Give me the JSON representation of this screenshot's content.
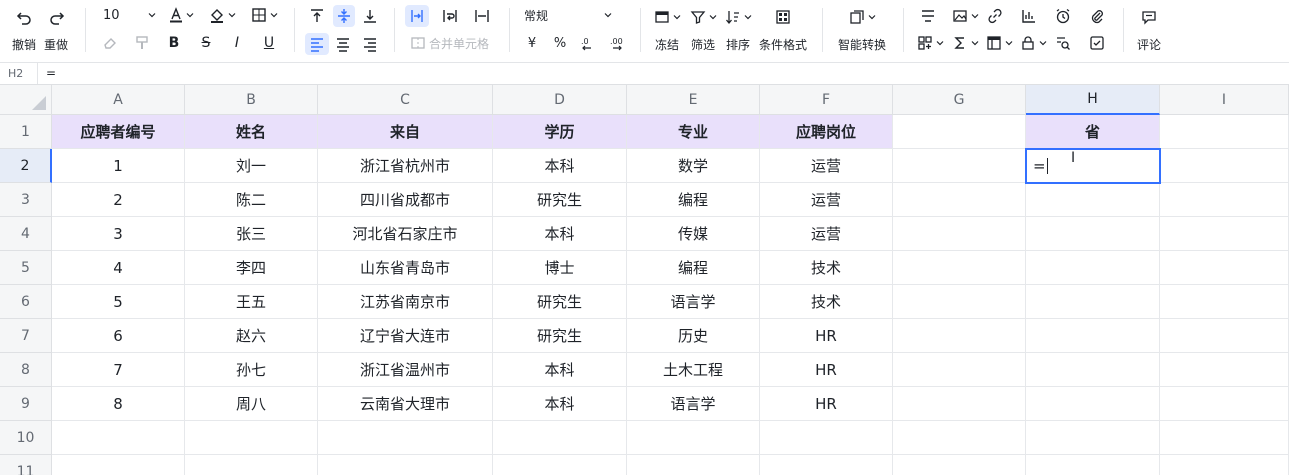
{
  "toolbar": {
    "undo_label": "撤销",
    "redo_label": "重做",
    "font_size": "10",
    "merge_label": "合并单元格",
    "number_format": "常规",
    "currency_symbol": "¥",
    "percent_symbol": "%",
    "freeze_label": "冻结",
    "filter_label": "筛选",
    "sort_label": "排序",
    "cond_format_label": "条件格式",
    "smart_convert_label": "智能转换",
    "comment_label": "评论"
  },
  "formula_bar": {
    "cell_ref": "H2",
    "formula": "="
  },
  "columns": [
    "A",
    "B",
    "C",
    "D",
    "E",
    "F",
    "G",
    "H",
    "I"
  ],
  "rows": [
    "1",
    "2",
    "3",
    "4",
    "5",
    "6",
    "7",
    "8",
    "9",
    "10",
    "11"
  ],
  "header_row": [
    "应聘者编号",
    "姓名",
    "来自",
    "学历",
    "专业",
    "应聘岗位",
    "",
    "省"
  ],
  "data_rows": [
    [
      "1",
      "刘一",
      "浙江省杭州市",
      "本科",
      "数学",
      "运营"
    ],
    [
      "2",
      "陈二",
      "四川省成都市",
      "研究生",
      "编程",
      "运营"
    ],
    [
      "3",
      "张三",
      "河北省石家庄市",
      "本科",
      "传媒",
      "运营"
    ],
    [
      "4",
      "李四",
      "山东省青岛市",
      "博士",
      "编程",
      "技术"
    ],
    [
      "5",
      "王五",
      "江苏省南京市",
      "研究生",
      "语言学",
      "技术"
    ],
    [
      "6",
      "赵六",
      "辽宁省大连市",
      "研究生",
      "历史",
      "HR"
    ],
    [
      "7",
      "孙七",
      "浙江省温州市",
      "本科",
      "土木工程",
      "HR"
    ],
    [
      "8",
      "周八",
      "云南省大理市",
      "本科",
      "语言学",
      "HR"
    ]
  ],
  "active_cell": {
    "ref": "H2",
    "editing_text": "="
  },
  "colors": {
    "accent": "#3370ff",
    "header_fill": "#e9e0fb",
    "selected_header": "#e6ecf7"
  }
}
